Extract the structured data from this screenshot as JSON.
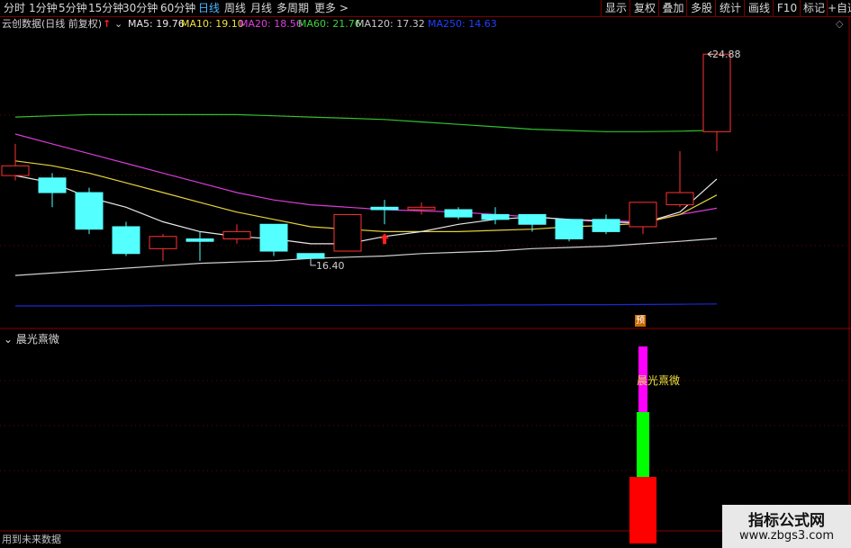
{
  "toolbar": {
    "periods": [
      {
        "label": "分时"
      },
      {
        "label": "1分钟"
      },
      {
        "label": "5分钟"
      },
      {
        "label": "15分钟"
      },
      {
        "label": "30分钟"
      },
      {
        "label": "60分钟"
      },
      {
        "label": "日线"
      },
      {
        "label": "周线"
      },
      {
        "label": "月线"
      },
      {
        "label": "多周期"
      },
      {
        "label": "更多 >"
      }
    ],
    "active_period": "日线",
    "right_buttons": [
      {
        "label": "显示"
      },
      {
        "label": "复权"
      },
      {
        "label": "叠加"
      },
      {
        "label": "多股"
      },
      {
        "label": "统计"
      },
      {
        "label": "画线"
      },
      {
        "label": "F10"
      },
      {
        "label": "标记"
      },
      {
        "label": "+自选"
      }
    ]
  },
  "info": {
    "title": "云创数据(日线 前复权)",
    "ma": [
      {
        "label": "MA5: 19.76",
        "color": "#e8e8e8"
      },
      {
        "label": "MA10: 19.10",
        "color": "#f0e040"
      },
      {
        "label": "MA20: 18.56",
        "color": "#e040e0"
      },
      {
        "label": "MA60: 21.76",
        "color": "#40d040"
      },
      {
        "label": "MA120: 17.32",
        "color": "#c8c8c8"
      },
      {
        "label": "MA250: 14.63",
        "color": "#2040ff"
      }
    ]
  },
  "price_labels": {
    "high": "24.88",
    "low": "16.40"
  },
  "predict_badge": "预",
  "indicator": {
    "title": "晨光熹微",
    "label": "晨光熹微"
  },
  "footer": "用到未来数据",
  "watermark": {
    "line1": "指标公式网",
    "line2": "www.zbgs3.com"
  },
  "chart_data": {
    "type": "candlestick",
    "title": "云创数据(日线 前复权)",
    "candles": [
      {
        "open": 19.9,
        "close": 20.3,
        "high": 21.2,
        "low": 19.7
      },
      {
        "open": 19.8,
        "close": 19.2,
        "high": 20.0,
        "low": 18.6
      },
      {
        "open": 19.2,
        "close": 17.7,
        "high": 19.4,
        "low": 17.5
      },
      {
        "open": 17.8,
        "close": 16.7,
        "high": 18.0,
        "low": 16.6
      },
      {
        "open": 16.9,
        "close": 17.4,
        "high": 17.5,
        "low": 16.4
      },
      {
        "open": 17.3,
        "close": 17.2,
        "high": 17.6,
        "low": 16.4
      },
      {
        "open": 17.3,
        "close": 17.6,
        "high": 17.9,
        "low": 17.1
      },
      {
        "open": 17.9,
        "close": 16.8,
        "high": 17.9,
        "low": 16.6
      },
      {
        "open": 16.7,
        "close": 16.5,
        "high": 16.7,
        "low": 16.4
      },
      {
        "open": 16.8,
        "close": 18.3,
        "high": 18.3,
        "low": 16.8
      },
      {
        "open": 18.6,
        "close": 18.5,
        "high": 18.9,
        "low": 17.9
      },
      {
        "open": 18.5,
        "close": 18.6,
        "high": 18.8,
        "low": 18.3
      },
      {
        "open": 18.5,
        "close": 18.2,
        "high": 18.6,
        "low": 18.1
      },
      {
        "open": 18.3,
        "close": 18.1,
        "high": 18.6,
        "low": 17.9
      },
      {
        "open": 18.3,
        "close": 17.9,
        "high": 18.3,
        "low": 17.6
      },
      {
        "open": 18.1,
        "close": 17.3,
        "high": 18.1,
        "low": 17.2
      },
      {
        "open": 18.1,
        "close": 17.6,
        "high": 18.3,
        "low": 17.5
      },
      {
        "open": 17.8,
        "close": 18.8,
        "high": 18.8,
        "low": 17.5
      },
      {
        "open": 18.7,
        "close": 19.2,
        "high": 20.9,
        "low": 18.6
      },
      {
        "open": 21.7,
        "close": 24.88,
        "high": 24.88,
        "low": 20.9
      }
    ],
    "ma5": [
      19.9,
      19.6,
      19.0,
      18.6,
      18.0,
      17.6,
      17.4,
      17.3,
      17.1,
      17.1,
      17.4,
      17.6,
      17.9,
      18.1,
      18.2,
      18.1,
      18.0,
      17.95,
      18.4,
      19.76
    ],
    "ma10": [
      20.5,
      20.3,
      20.0,
      19.6,
      19.2,
      18.8,
      18.4,
      18.1,
      17.8,
      17.7,
      17.6,
      17.6,
      17.6,
      17.65,
      17.7,
      17.8,
      17.85,
      17.95,
      18.3,
      19.1
    ],
    "ma20": [
      21.6,
      21.2,
      20.8,
      20.4,
      20.0,
      19.6,
      19.2,
      18.9,
      18.7,
      18.6,
      18.5,
      18.45,
      18.4,
      18.3,
      18.2,
      18.1,
      18.05,
      18.0,
      18.3,
      18.56
    ],
    "ma60": [
      22.3,
      22.35,
      22.4,
      22.4,
      22.4,
      22.4,
      22.4,
      22.35,
      22.3,
      22.25,
      22.2,
      22.1,
      22.0,
      21.9,
      21.8,
      21.75,
      21.7,
      21.7,
      21.72,
      21.76
    ],
    "ma120": [
      15.8,
      15.9,
      16.0,
      16.1,
      16.2,
      16.3,
      16.35,
      16.4,
      16.5,
      16.55,
      16.6,
      16.7,
      16.75,
      16.8,
      16.9,
      16.95,
      17.0,
      17.1,
      17.2,
      17.32
    ],
    "ma250": [
      14.55,
      14.55,
      14.55,
      14.55,
      14.56,
      14.56,
      14.56,
      14.57,
      14.57,
      14.57,
      14.58,
      14.58,
      14.58,
      14.59,
      14.59,
      14.6,
      14.6,
      14.61,
      14.62,
      14.63
    ],
    "high_marker": "24.88",
    "low_marker": "16.40",
    "ylim": [
      13.7,
      25.7
    ],
    "indicator_bars": [
      {
        "color": "#ff0000",
        "from": 0,
        "to": 1.0
      },
      {
        "color": "#00ff00",
        "from": 1.0,
        "to": 1.0
      },
      {
        "color": "#ff00ff",
        "from": 2.0,
        "to": 1.0
      }
    ]
  }
}
